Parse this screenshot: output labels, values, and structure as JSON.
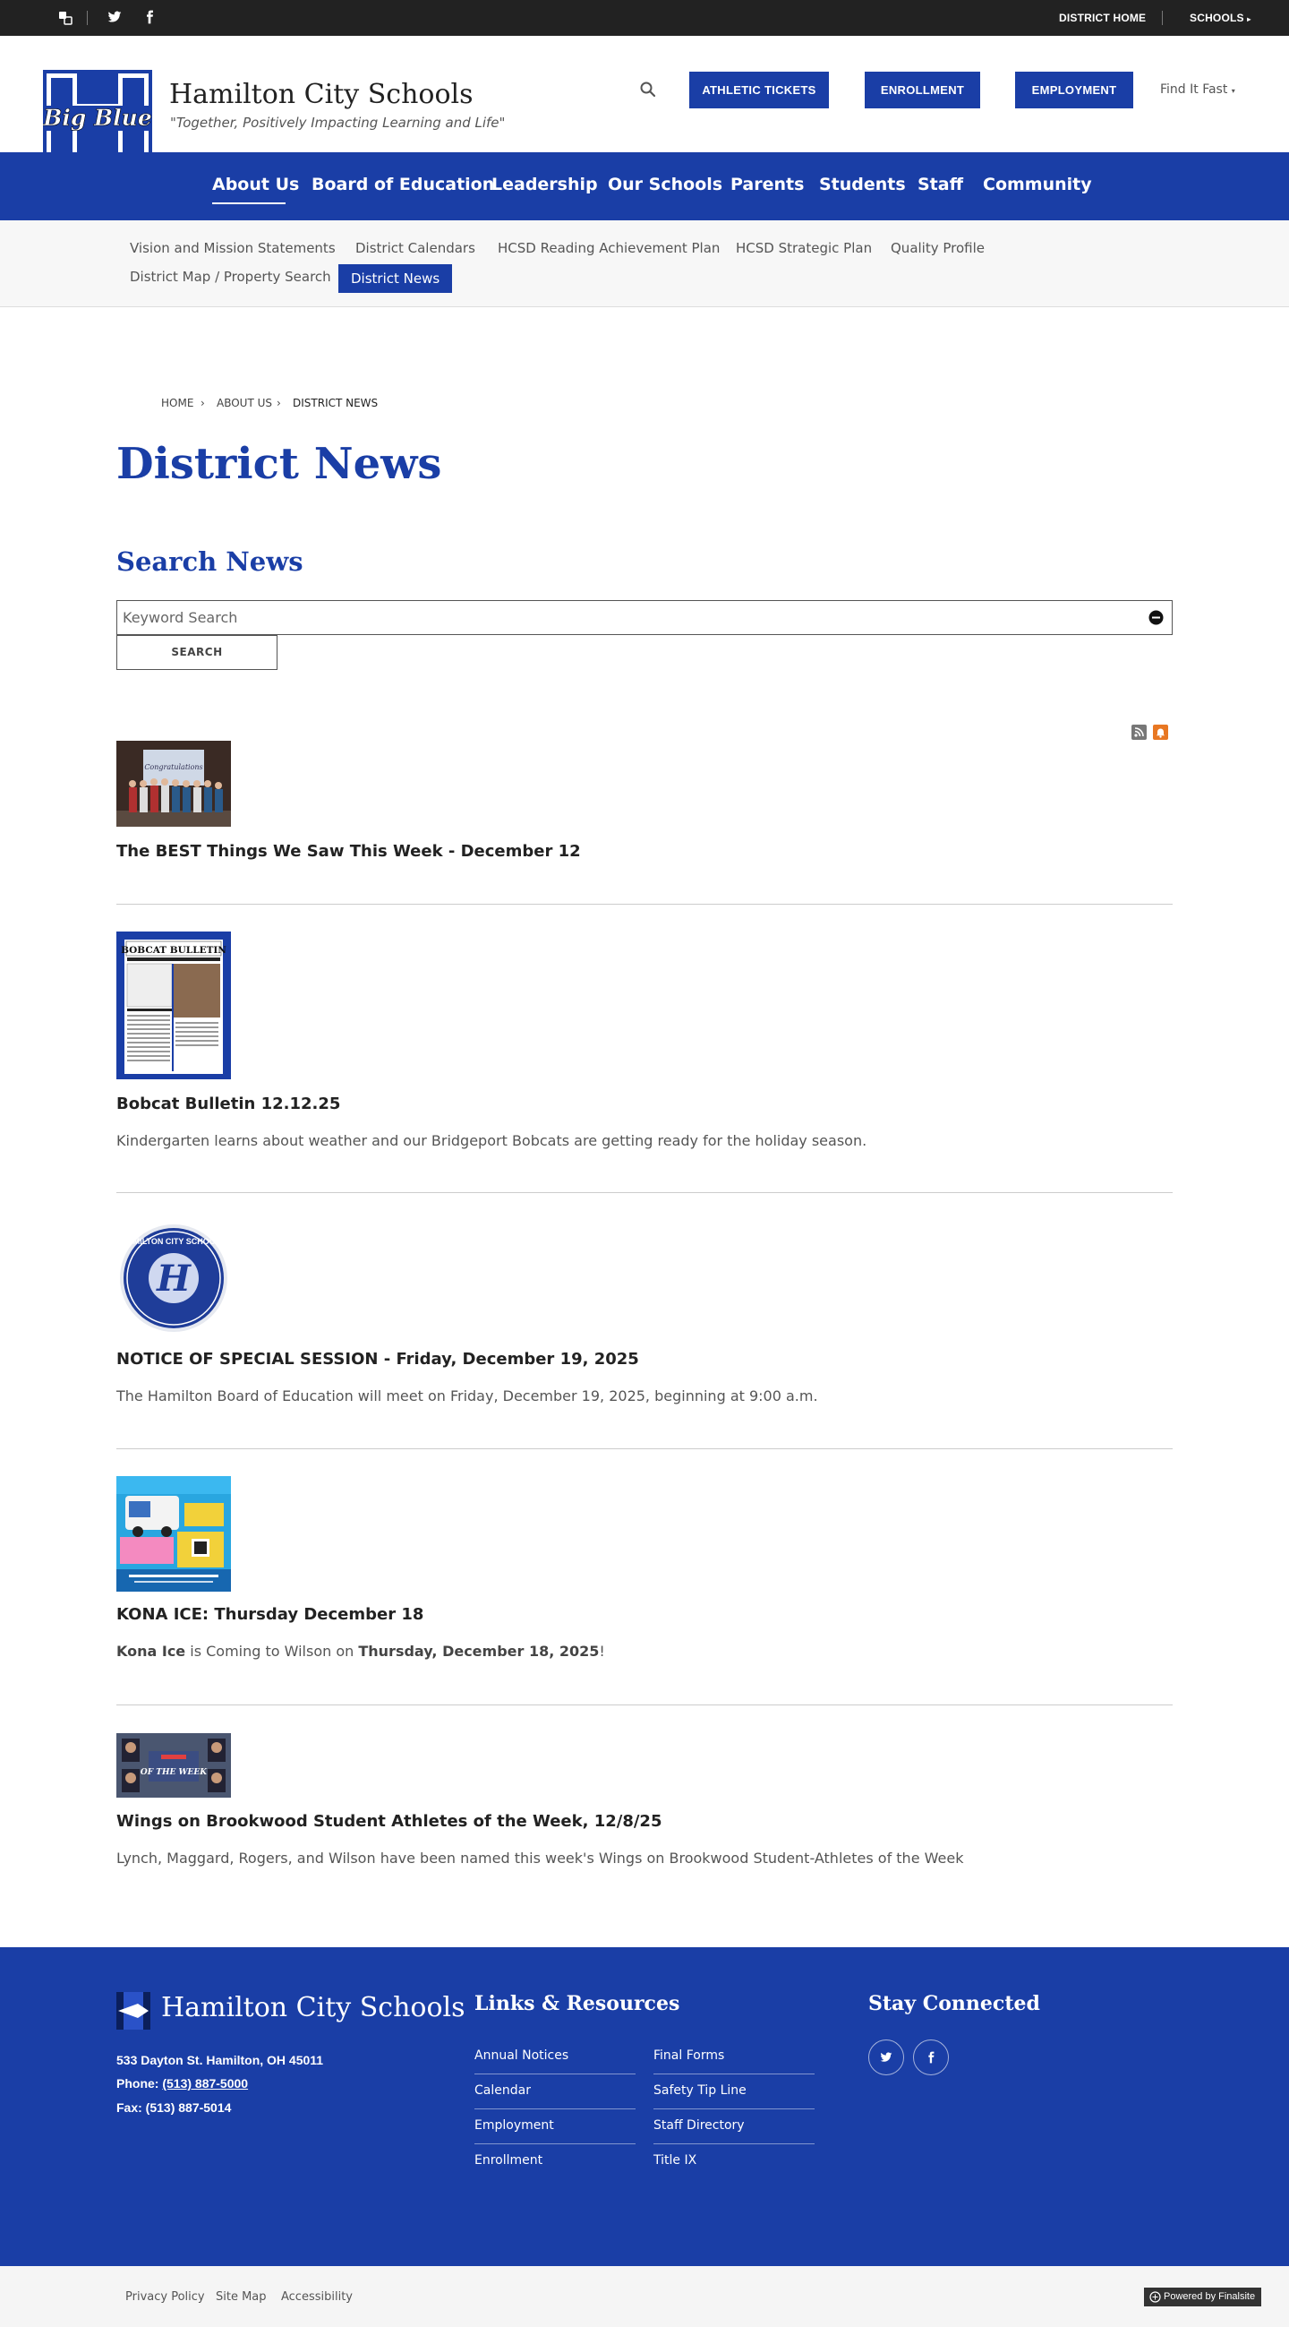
{
  "topbar": {
    "district_home": "DISTRICT HOME",
    "schools": "SCHOOLS"
  },
  "header": {
    "site_name": "Hamilton City Schools",
    "tagline": "\"Together, Positively Impacting Learning and Life\"",
    "logo_text": "Big Blue",
    "buttons": [
      "ATHLETIC TICKETS",
      "ENROLLMENT",
      "EMPLOYMENT"
    ],
    "find_it_fast": "Find It Fast"
  },
  "main_nav": [
    "About Us",
    "Board of Education",
    "Leadership",
    "Our Schools",
    "Parents",
    "Students",
    "Staff",
    "Community"
  ],
  "sub_nav": {
    "row1": [
      "Vision and Mission Statements",
      "District Calendars",
      "HCSD Reading Achievement Plan",
      "HCSD Strategic Plan",
      "Quality Profile"
    ],
    "row2": [
      "District Map / Property Search",
      "District News"
    ]
  },
  "breadcrumb": [
    "HOME",
    "ABOUT US",
    "DISTRICT NEWS"
  ],
  "page_title": "District News",
  "search": {
    "title": "Search News",
    "placeholder": "Keyword Search",
    "button": "SEARCH"
  },
  "news": [
    {
      "title": "The BEST Things We Saw This Week - December 12",
      "desc": ""
    },
    {
      "title": "Bobcat Bulletin 12.12.25",
      "desc": "Kindergarten learns about weather and our Bridgeport Bobcats are getting ready for the holiday season.",
      "thumb_text": "BOBCAT BULLETIN"
    },
    {
      "title": "NOTICE OF SPECIAL SESSION - Friday, December 19, 2025",
      "desc": "The Hamilton Board of Education will meet on Friday, December 19, 2025, beginning at 9:00 a.m.",
      "thumb_text": "HAMILTON CITY SCHOOLS"
    },
    {
      "title": "KONA ICE: Thursday December 18",
      "desc_parts": [
        "Kona Ice",
        " is Coming to Wilson on ",
        "Thursday, December 18, 2025",
        "!"
      ]
    },
    {
      "title": "Wings on Brookwood Student Athletes of the Week, 12/8/25",
      "desc": "Lynch, Maggard, Rogers, and Wilson have been named this week's Wings on Brookwood Student-Athletes of the Week",
      "thumb_text": "OF THE WEEK"
    }
  ],
  "footer": {
    "name": "Hamilton City Schools",
    "address": "533 Dayton St. Hamilton, OH  45011",
    "phone_label": "Phone: ",
    "phone": "(513) 887-5000",
    "fax": "Fax: (513) 887-5014",
    "links_title": "Links & Resources",
    "links_col1": [
      "Annual Notices",
      "Calendar",
      "Employment",
      "Enrollment"
    ],
    "links_col2": [
      "Final Forms",
      "Safety Tip Line",
      "Staff Directory",
      "Title IX"
    ],
    "connect_title": "Stay Connected"
  },
  "bottom": {
    "links": [
      "Privacy Policy",
      "Site Map",
      "Accessibility"
    ],
    "powered": "Powered by Finalsite"
  },
  "colors": {
    "brand_blue": "#1a3ea6",
    "topbar": "#222222"
  }
}
